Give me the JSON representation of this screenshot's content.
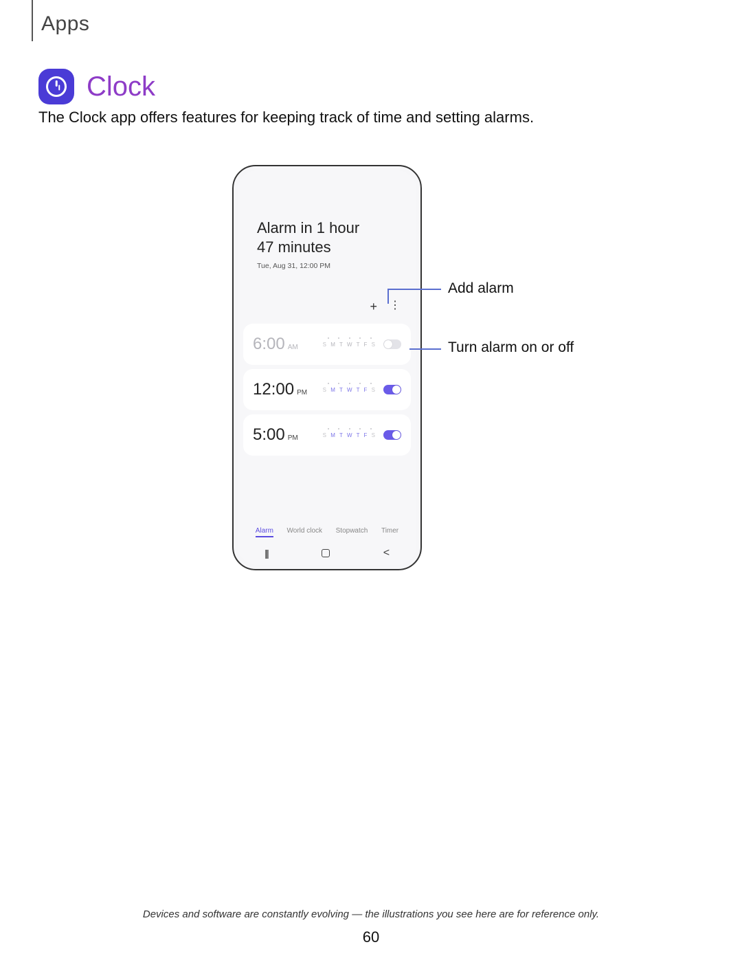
{
  "section": "Apps",
  "title": "Clock",
  "intro": "The Clock app offers features for keeping track of time and setting alarms.",
  "phone": {
    "header_line1": "Alarm in 1 hour",
    "header_line2": "47 minutes",
    "date": "Tue, Aug 31, 12:00 PM",
    "alarms": [
      {
        "time": "6:00",
        "ampm": "AM",
        "days_active": "MTWTF",
        "enabled": false
      },
      {
        "time": "12:00",
        "ampm": "PM",
        "days_active": "MTWTF",
        "enabled": true
      },
      {
        "time": "5:00",
        "ampm": "PM",
        "days_active": "MTWTF",
        "enabled": true
      }
    ],
    "tabs": [
      "Alarm",
      "World clock",
      "Stopwatch",
      "Timer"
    ],
    "active_tab": "Alarm"
  },
  "callouts": {
    "add_alarm": "Add alarm",
    "toggle": "Turn alarm on or off"
  },
  "footer": "Devices and software are constantly evolving — the illustrations you see here are for reference only.",
  "page": "60"
}
